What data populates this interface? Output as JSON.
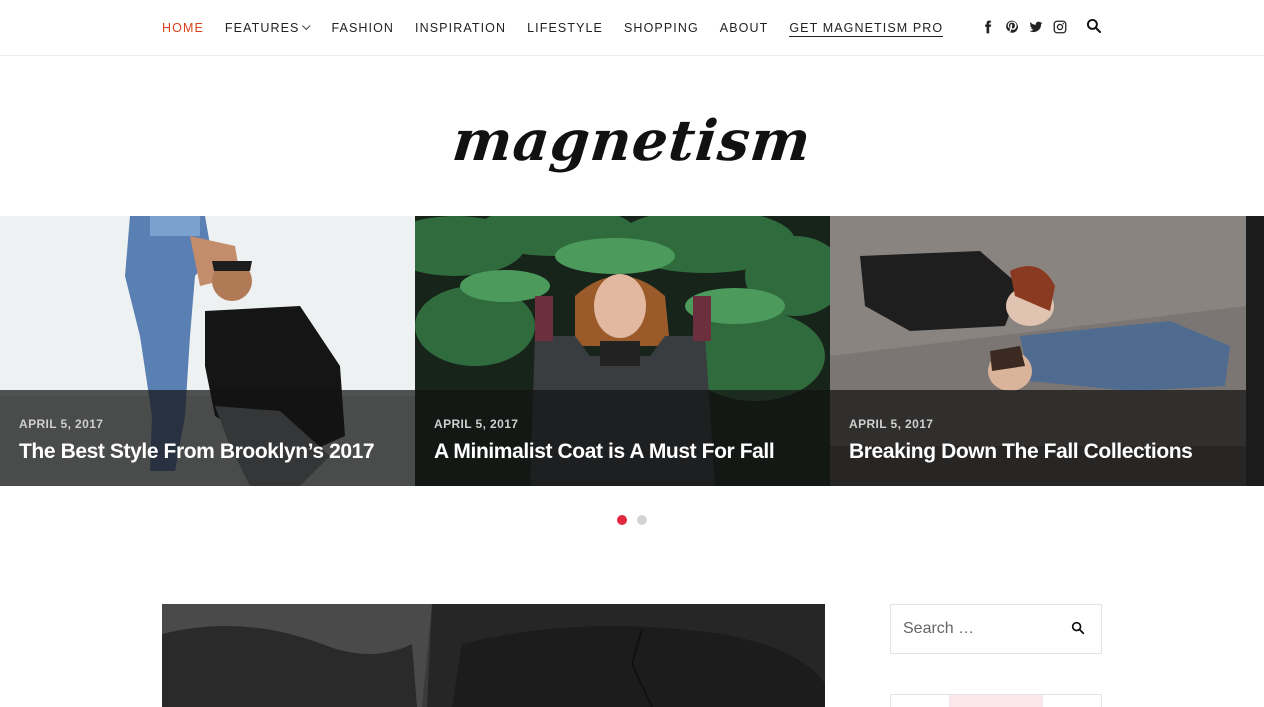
{
  "nav": {
    "items": [
      {
        "label": "HOME",
        "active": true
      },
      {
        "label": "FEATURES",
        "has_dropdown": true
      },
      {
        "label": "FASHION"
      },
      {
        "label": "INSPIRATION"
      },
      {
        "label": "LIFESTYLE"
      },
      {
        "label": "SHOPPING"
      },
      {
        "label": "ABOUT"
      },
      {
        "label": "GET MAGNETISM PRO"
      }
    ],
    "social_icons": [
      "facebook-icon",
      "pinterest-icon",
      "twitter-icon",
      "instagram-icon"
    ],
    "search_icon": "search-icon",
    "accent_color": "#d9421c"
  },
  "logo": {
    "text": "magnetism"
  },
  "slider": {
    "slides": [
      {
        "date": "APRIL 5, 2017",
        "title": "The Best Style From Brooklyn’s 2017"
      },
      {
        "date": "APRIL 5, 2017",
        "title": "A Minimalist Coat is A Must For Fall"
      },
      {
        "date": "APRIL 5, 2017",
        "title": "Breaking Down The Fall Collections"
      }
    ],
    "dots": {
      "count": 2,
      "active_index": 0
    },
    "dot_active_color": "#e32840"
  },
  "sidebar": {
    "search": {
      "placeholder": "Search …"
    }
  }
}
